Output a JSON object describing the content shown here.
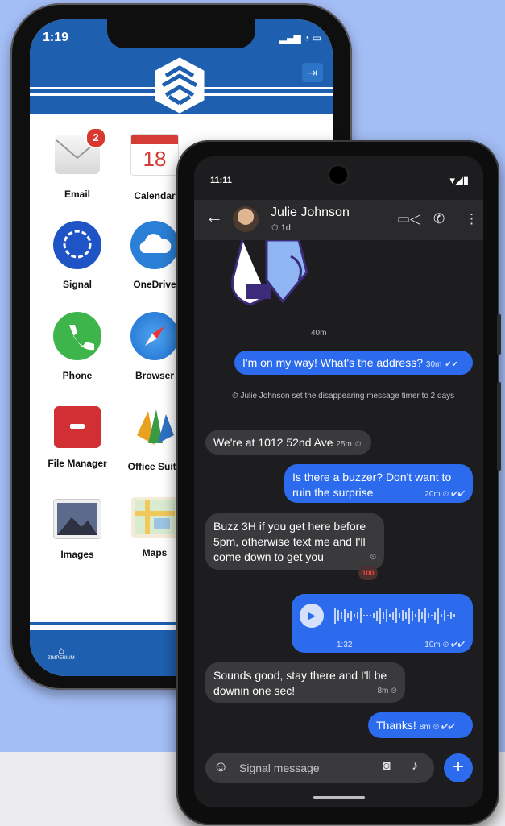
{
  "ios": {
    "time": "1:19",
    "apps": [
      {
        "label": "Email",
        "icon": "mail-icon",
        "badge": "2"
      },
      {
        "label": "Calendar",
        "icon": "calendar-icon",
        "date": "18"
      },
      {
        "label": "Signal",
        "icon": "signal-icon"
      },
      {
        "label": "OneDrive",
        "icon": "cloud-icon"
      },
      {
        "label": "Phone",
        "icon": "phone-icon"
      },
      {
        "label": "Browser",
        "icon": "compass-icon"
      },
      {
        "label": "File Manager",
        "icon": "folder-icon"
      },
      {
        "label": "Office Suite",
        "icon": "office-icon"
      },
      {
        "label": "Images",
        "icon": "image-icon"
      },
      {
        "label": "Maps",
        "icon": "map-icon"
      }
    ],
    "dock_brand": "ZIMPERIUM"
  },
  "android": {
    "time": "11:11",
    "contact_name": "Julie Johnson",
    "timer": "1d",
    "messages": [
      {
        "time_divider": "40m"
      },
      {
        "dir": "out",
        "text": "I'm on my way! What's the address?",
        "meta": "30m"
      },
      {
        "system": "Julie Johnson set the disappearing message timer to 2 days"
      },
      {
        "dir": "in",
        "text": "We're at 1012 52nd Ave",
        "meta": "25m"
      },
      {
        "dir": "out",
        "text": "Is there a buzzer? Don't want to ruin the surprise",
        "meta": "20m"
      },
      {
        "dir": "in",
        "text": "Buzz 3H if you get here before 5pm, otherwise text me and I'll come down to get you",
        "reaction": "100"
      },
      {
        "dir": "out",
        "voice_duration": "1:32",
        "meta": "10m"
      },
      {
        "dir": "in",
        "text": "Sounds good, stay there and I'll be downin one sec!",
        "meta": "8m"
      },
      {
        "dir": "out",
        "text": "Thanks!",
        "meta": "8m"
      }
    ],
    "composer_placeholder": "Signal message"
  },
  "colors": {
    "ios_blue": "#1e5fb0",
    "signal_blue": "#2c6bed",
    "bg": "#a3bdf5"
  }
}
